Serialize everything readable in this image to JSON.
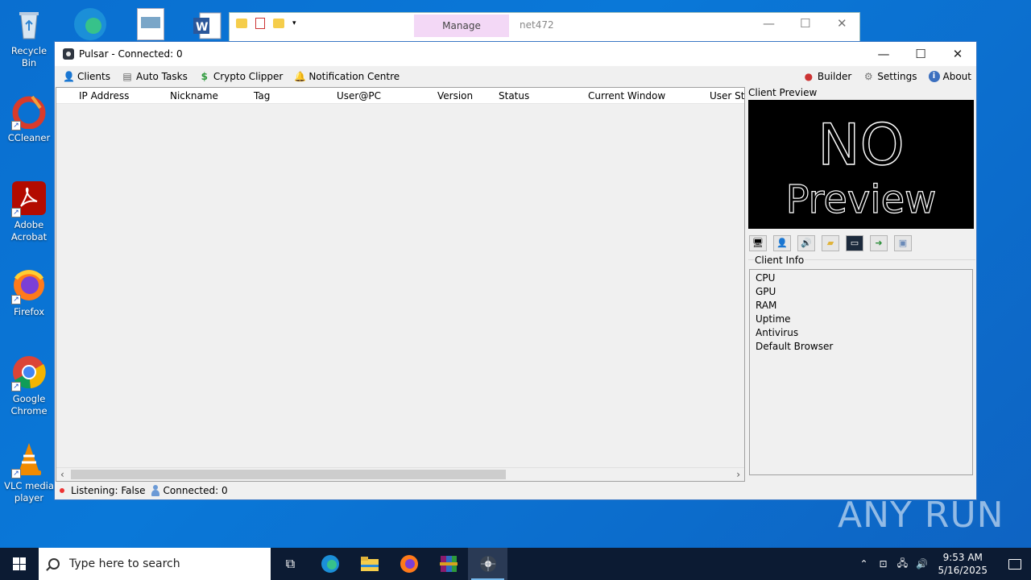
{
  "desktop": {
    "icons": [
      {
        "label": "Recycle Bin"
      },
      {
        "label": "CCleaner"
      },
      {
        "label": "Adobe Acrobat"
      },
      {
        "label": "Firefox"
      },
      {
        "label": "Google Chrome"
      },
      {
        "label": "VLC media player"
      }
    ]
  },
  "bg_window": {
    "manage_tab": "Manage",
    "title": "net472"
  },
  "window": {
    "title": "Pulsar - Connected: 0",
    "menu": {
      "clients": "Clients",
      "auto_tasks": "Auto Tasks",
      "crypto_clipper": "Crypto Clipper",
      "notification_centre": "Notification Centre",
      "builder": "Builder",
      "settings": "Settings",
      "about": "About"
    },
    "columns": [
      "IP Address",
      "Nickname",
      "Tag",
      "User@PC",
      "Version",
      "Status",
      "Current Window",
      "User Sta"
    ],
    "client_preview_label": "Client Preview",
    "preview_text_line1": "NO",
    "preview_text_line2": "Preview",
    "client_info_label": "Client Info",
    "client_info_items": [
      "CPU",
      "GPU",
      "RAM",
      "Uptime",
      "Antivirus",
      "Default Browser"
    ],
    "status": {
      "listening": "Listening: False",
      "connected": "Connected: 0"
    }
  },
  "watermark": "ANY RUN",
  "taskbar": {
    "search_placeholder": "Type here to search",
    "time": "9:53 AM",
    "date": "5/16/2025"
  }
}
